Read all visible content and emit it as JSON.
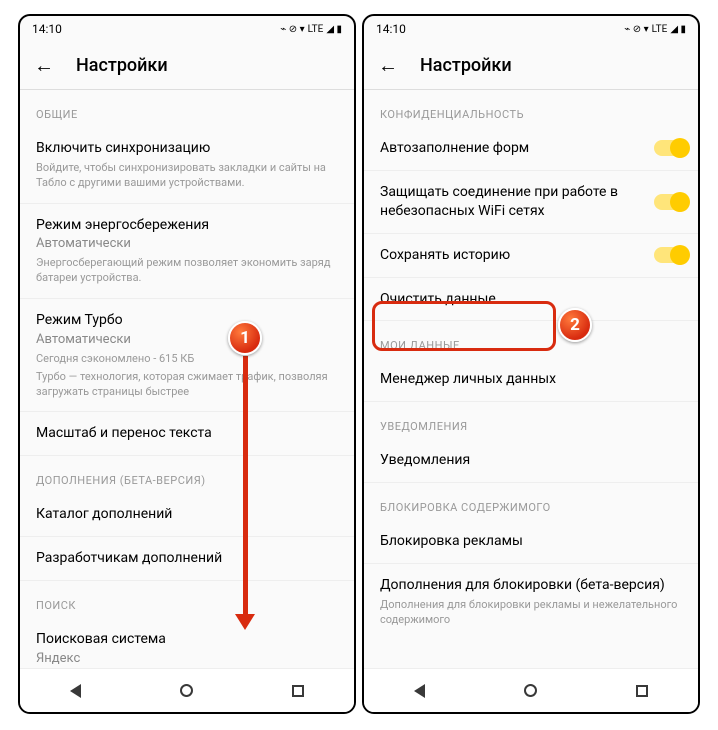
{
  "status": {
    "time": "14:10",
    "network": "LTE"
  },
  "header": {
    "title": "Настройки"
  },
  "left": {
    "sections": {
      "general": {
        "label": "ОБЩИЕ",
        "sync": {
          "title": "Включить синхронизацию",
          "desc": "Войдите, чтобы синхронизировать закладки и сайты на Табло с другими вашими устройствами."
        },
        "power": {
          "title": "Режим энергосбережения",
          "sub": "Автоматически",
          "desc": "Энергосберегающий режим позволяет экономить заряд батареи устройства."
        },
        "turbo": {
          "title": "Режим Турбо",
          "sub": "Автоматически",
          "desc1": "Сегодня сэкономлено - 615 КБ",
          "desc2": "Турбо — технология, которая сжимает трафик, позволяя загружать страницы быстрее"
        },
        "scale": {
          "title": "Масштаб и перенос текста"
        }
      },
      "addons": {
        "label": "ДОПОЛНЕНИЯ (БЕТА-ВЕРСИЯ)",
        "catalog": {
          "title": "Каталог дополнений"
        },
        "devs": {
          "title": "Разработчикам дополнений"
        }
      },
      "search": {
        "label": "ПОИСК",
        "engine": {
          "title": "Поисковая система",
          "sub": "Яндекс"
        }
      }
    }
  },
  "right": {
    "sections": {
      "privacy": {
        "label": "КОНФИДЕНЦИАЛЬНОСТЬ",
        "autofill": {
          "title": "Автозаполнение форм"
        },
        "protect": {
          "title": "Защищать соединение при работе в небезопасных WiFi сетях"
        },
        "history": {
          "title": "Сохранять историю"
        },
        "clear": {
          "title": "Очистить данные"
        }
      },
      "mydata": {
        "label": "МОИ ДАННЫЕ",
        "manager": {
          "title": "Менеджер личных данных"
        }
      },
      "notif": {
        "label": "УВЕДОМЛЕНИЯ",
        "item": {
          "title": "Уведомления"
        }
      },
      "block": {
        "label": "БЛОКИРОВКА СОДЕРЖИМОГО",
        "ads": {
          "title": "Блокировка рекламы"
        },
        "addons": {
          "title": "Дополнения для блокировки (бета-версия)",
          "desc": "Дополнения для блокировки рекламы и нежелательного содержимого"
        }
      }
    }
  },
  "markers": {
    "one": "1",
    "two": "2"
  }
}
